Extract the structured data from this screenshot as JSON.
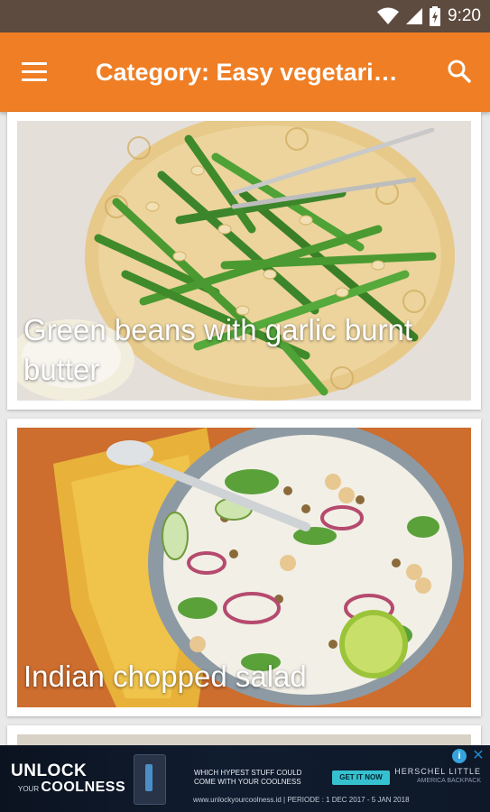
{
  "status_bar": {
    "time": "9:20"
  },
  "app_bar": {
    "title": "Category: Easy vegetari…",
    "accent": "#ef7e24"
  },
  "recipes": [
    {
      "title": "Green beans with garlic burnt butter"
    },
    {
      "title": "Indian chopped salad"
    },
    {
      "title": ""
    }
  ],
  "ad": {
    "logo_line1": "UNLOCK",
    "logo_line2_prefix": "YOUR",
    "logo_line2": "COOLNESS",
    "headline_line1": "WHICH HYPEST STUFF COULD",
    "headline_line2": "COME WITH YOUR COOLNESS",
    "cta": "GET IT NOW",
    "brand": "HERSCHEL LITTLE",
    "brand_sub": "AMERICA BACKPACK",
    "footer": "www.unlockyourcoolness.id | PERIODE : 1 DEC 2017 - 5 JAN 2018"
  }
}
